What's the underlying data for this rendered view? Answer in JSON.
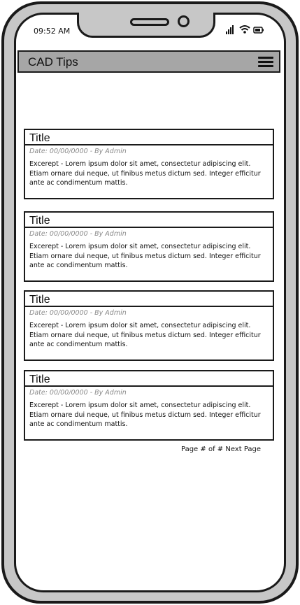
{
  "status_bar": {
    "time": "09:52 AM",
    "icons": [
      "signal-icon",
      "wifi-icon",
      "battery-icon"
    ]
  },
  "header": {
    "title": "CAD Tips",
    "menu_icon": "hamburger-menu-icon"
  },
  "posts": [
    {
      "title": "Title",
      "meta": "Date: 00/00/0000 - By Admin",
      "excerpt": "Excerept - Lorem ipsum dolor sit amet, consectetur adipiscing elit. Etiam ornare dui neque, ut finibus metus dictum sed. Integer efficitur ante ac condimentum mattis."
    },
    {
      "title": "Title",
      "meta": "Date: 00/00/0000 - By Admin",
      "excerpt": "Excerept - Lorem ipsum dolor sit amet, consectetur adipiscing elit. Etiam ornare dui neque, ut finibus metus dictum sed. Integer efficitur ante ac condimentum mattis."
    },
    {
      "title": "Title",
      "meta": "Date: 00/00/0000 - By Admin",
      "excerpt": "Excerept - Lorem ipsum dolor sit amet, consectetur adipiscing elit. Etiam ornare dui neque, ut finibus metus dictum sed. Integer efficitur ante ac condimentum mattis."
    },
    {
      "title": "Title",
      "meta": "Date: 00/00/0000 - By Admin",
      "excerpt": "Excerept - Lorem ipsum dolor sit amet, consectetur adipiscing elit. Etiam ornare dui neque, ut finibus metus dictum sed. Integer efficitur ante ac condimentum mattis."
    }
  ],
  "pagination": {
    "page_text": "Page # of #",
    "next_label": "Next Page"
  },
  "colors": {
    "header_bg": "#a6a6a6",
    "frame": "#c7c7c7",
    "outline": "#1a1a1a",
    "meta_text": "#8a8a8a"
  }
}
